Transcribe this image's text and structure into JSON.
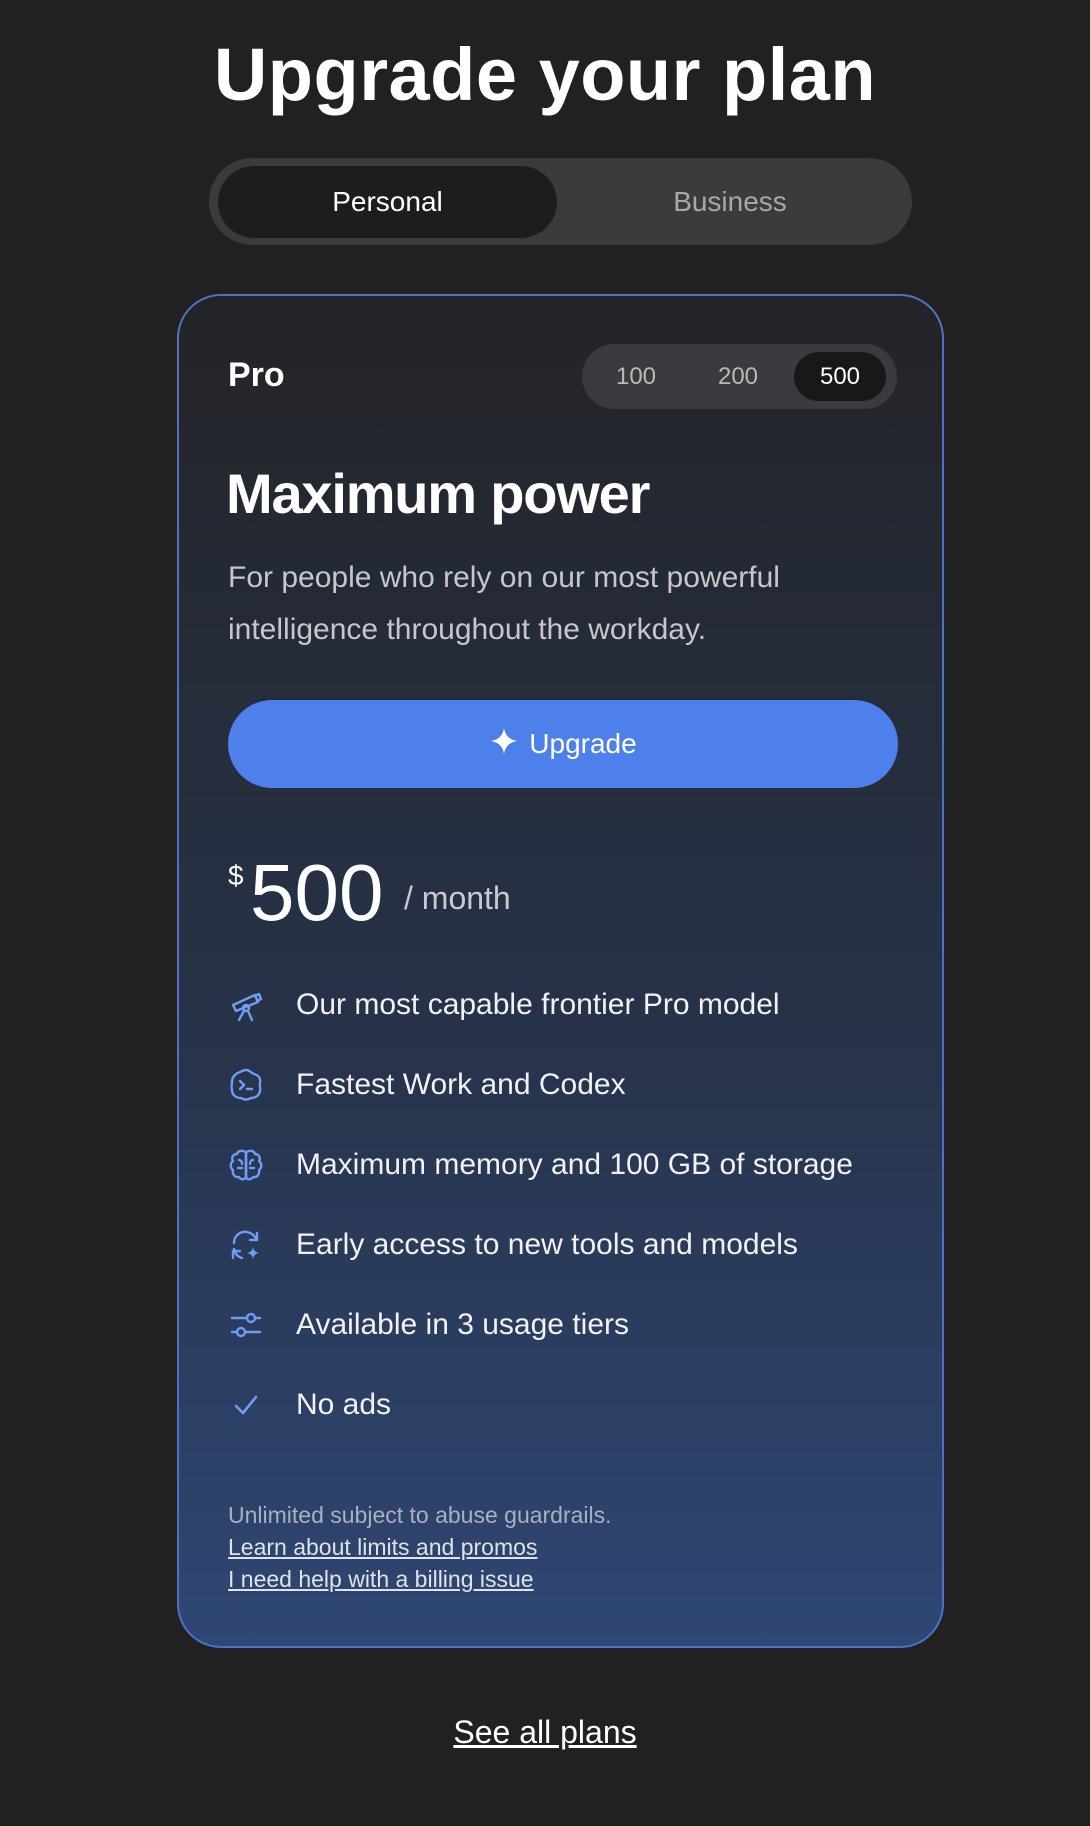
{
  "header": {
    "title": "Upgrade your plan"
  },
  "segments": {
    "options": [
      "Personal",
      "Business"
    ],
    "selected": "Personal"
  },
  "plan": {
    "name": "Pro",
    "tiers": [
      "100",
      "200",
      "500"
    ],
    "selected_tier": "500",
    "headline": "Maximum power",
    "description": "For people who rely on our most powerful intelligence throughout the workday.",
    "upgrade_label": "Upgrade",
    "price": {
      "currency": "$",
      "amount": "500",
      "period": "/ month"
    },
    "features": [
      {
        "icon": "telescope-icon",
        "text": "Our most capable frontier Pro model"
      },
      {
        "icon": "terminal-badge-icon",
        "text": "Fastest Work and Codex"
      },
      {
        "icon": "brain-icon",
        "text": "Maximum memory and 100 GB of storage"
      },
      {
        "icon": "refresh-sparkle-icon",
        "text": "Early access to new tools and models"
      },
      {
        "icon": "sliders-icon",
        "text": "Available in 3 usage tiers"
      },
      {
        "icon": "checkmark-icon",
        "text": "No ads"
      }
    ],
    "footnote": "Unlimited subject to abuse guardrails.",
    "links": [
      "Learn about limits and promos",
      "I need help with a billing issue"
    ]
  },
  "footer": {
    "see_all_label": "See all plans"
  },
  "colors": {
    "background": "#212121",
    "accent": "#4d80ea",
    "card_border": "#4f71c4",
    "icon": "#6f9cf5"
  }
}
